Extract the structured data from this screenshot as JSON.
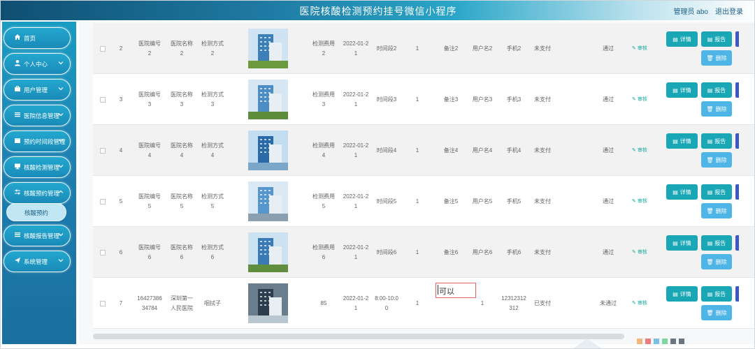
{
  "header": {
    "title": "医院核酸检测预约挂号微信小程序",
    "user": "管理员 abo",
    "logout": "退出登录"
  },
  "sidebar": {
    "items": [
      {
        "label": "首页",
        "icon": "home-icon",
        "has_chevron": false
      },
      {
        "label": "个人中心",
        "icon": "user-icon",
        "has_chevron": true
      },
      {
        "label": "用户管理",
        "icon": "briefcase-icon",
        "has_chevron": true
      },
      {
        "label": "医院信息管理",
        "icon": "list-icon",
        "has_chevron": true
      },
      {
        "label": "预约时间段管理",
        "icon": "calendar-icon",
        "has_chevron": true
      },
      {
        "label": "核酸检测管理",
        "icon": "monitor-icon",
        "has_chevron": true
      },
      {
        "label": "核酸预约管理",
        "icon": "sliders-icon",
        "has_chevron": true
      },
      {
        "label": "核酸报告管理",
        "icon": "list-icon",
        "has_chevron": true
      },
      {
        "label": "系统管理",
        "icon": "send-icon",
        "has_chevron": true
      }
    ],
    "active_sub": "核酸预约"
  },
  "buttons": {
    "detail": "详情",
    "report": "报告",
    "delete": "删除",
    "audit": "审核"
  },
  "rows": [
    {
      "index": "2",
      "hospital_no": "医院编号\n2",
      "hospital_name": "医院名称\n2",
      "method": "检测方式\n2",
      "fee": "检测费用\n2",
      "date": "2022-01-2\n1",
      "time": "时间段2",
      "count": "1",
      "remark": "备注2",
      "username": "用户名2",
      "phone": "手机2",
      "pay": "未支付",
      "review": "通过"
    },
    {
      "index": "3",
      "hospital_no": "医院编号\n3",
      "hospital_name": "医院名称\n3",
      "method": "检测方式\n3",
      "fee": "检测费用\n3",
      "date": "2022-01-2\n1",
      "time": "时间段3",
      "count": "1",
      "remark": "备注3",
      "username": "用户名3",
      "phone": "手机3",
      "pay": "未支付",
      "review": "通过"
    },
    {
      "index": "4",
      "hospital_no": "医院编号\n4",
      "hospital_name": "医院名称\n4",
      "method": "检测方式\n4",
      "fee": "检测费用\n4",
      "date": "2022-01-2\n1",
      "time": "时间段4",
      "count": "1",
      "remark": "备注4",
      "username": "用户名4",
      "phone": "手机4",
      "pay": "未支付",
      "review": "通过"
    },
    {
      "index": "5",
      "hospital_no": "医院编号\n5",
      "hospital_name": "医院名称\n5",
      "method": "检测方式\n5",
      "fee": "检测费用\n5",
      "date": "2022-01-2\n1",
      "time": "时间段5",
      "count": "1",
      "remark": "备注5",
      "username": "用户名5",
      "phone": "手机5",
      "pay": "未支付",
      "review": "通过"
    },
    {
      "index": "6",
      "hospital_no": "医院编号\n6",
      "hospital_name": "医院名称\n6",
      "method": "检测方式\n6",
      "fee": "检测费用\n6",
      "date": "2022-01-2\n1",
      "time": "时间段6",
      "count": "1",
      "remark": "备注6",
      "username": "用户名6",
      "phone": "手机6",
      "pay": "未支付",
      "review": "通过"
    },
    {
      "index": "7",
      "hospital_no": "16427386\n34784",
      "hospital_name": "深圳第一\n人民医院",
      "method": "咽拭子",
      "fee": "85",
      "date": "2022-01-2\n1",
      "time": "8:00-10:0\n0",
      "count": "1",
      "remark": "",
      "username": "1",
      "phone": "12312312\n312",
      "pay": "已支付",
      "review": "未通过"
    }
  ],
  "editing": {
    "text": "可以"
  }
}
